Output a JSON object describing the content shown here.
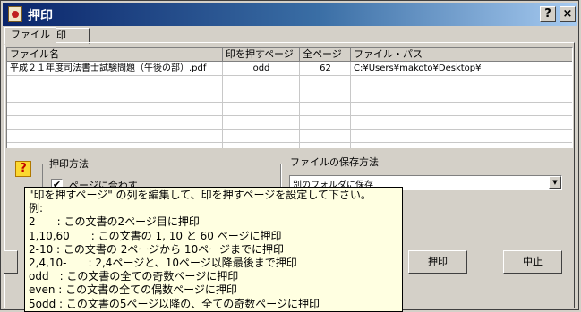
{
  "window": {
    "title": "押印"
  },
  "title_buttons": {
    "help": "?",
    "close": "×"
  },
  "tabs": [
    "ファイル",
    "印"
  ],
  "grid": {
    "headers": [
      "ファイル名",
      "印を押すページ",
      "全ページ",
      "ファイル・パス"
    ],
    "rows": [
      [
        "平成２１年度司法書士試験問題（午後の部）.pdf",
        "odd",
        "62",
        "C:¥Users¥makoto¥Desktop¥"
      ]
    ]
  },
  "stamp_method": {
    "label": "押印方法",
    "fit_page_label": "ページに合わす",
    "fit_page_checked": "✔"
  },
  "save_method": {
    "label": "ファイルの保存方法",
    "selected": "別のフォルダに保存"
  },
  "buttons": {
    "stamp": "押印",
    "cancel": "中止"
  },
  "tooltip": {
    "lines": [
      "\"印を押すページ\" の列を編集して、印を押すページを設定して下さい。",
      "例:",
      "2　　: この文書の2ページ目に押印",
      "1,10,60　　: この文書の 1, 10 と 60 ページに押印",
      "2-10 : この文書の 2ページから 10ページまでに押印",
      "2,4,10-　　: 2,4ページと、10ページ以降最後まで押印",
      "odd　: この文書の全ての奇数ページに押印",
      "even : この文書の全ての偶数ページに押印",
      "5odd : この文書の5ページ以降の、全ての奇数ページに押印"
    ]
  },
  "colors": {
    "titlebar_start": "#0a246a",
    "titlebar_end": "#a6caf0",
    "tooltip_bg": "#ffffe1",
    "face": "#d4d0c8"
  }
}
